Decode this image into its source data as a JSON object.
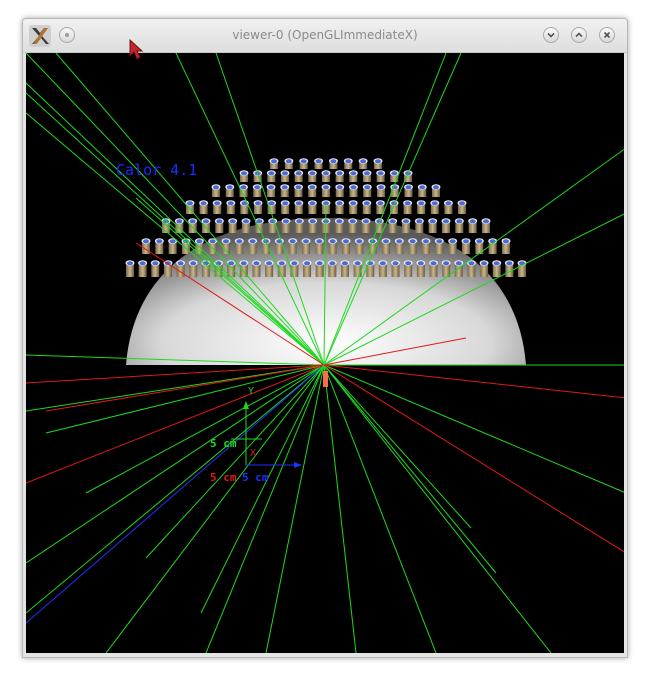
{
  "window": {
    "title": "viewer-0 (OpenGLImmediateX)"
  },
  "titlebar_buttons": {
    "left": "dot-icon",
    "right": [
      "chevron-down-icon",
      "chevron-up-icon",
      "close-icon"
    ]
  },
  "scene": {
    "overlay_text": "Calor 4.1",
    "axes": {
      "y_label": "Y",
      "x_label": "X",
      "green_scale": "5 cm",
      "red_scale": "5 cm",
      "blue_scale": "5 cm"
    }
  },
  "colors": {
    "background": "#000000",
    "track_green": "#1ed81e",
    "track_red": "#e01818",
    "axis_blue": "#2030ff",
    "overlay_text": "#1a2bff"
  }
}
